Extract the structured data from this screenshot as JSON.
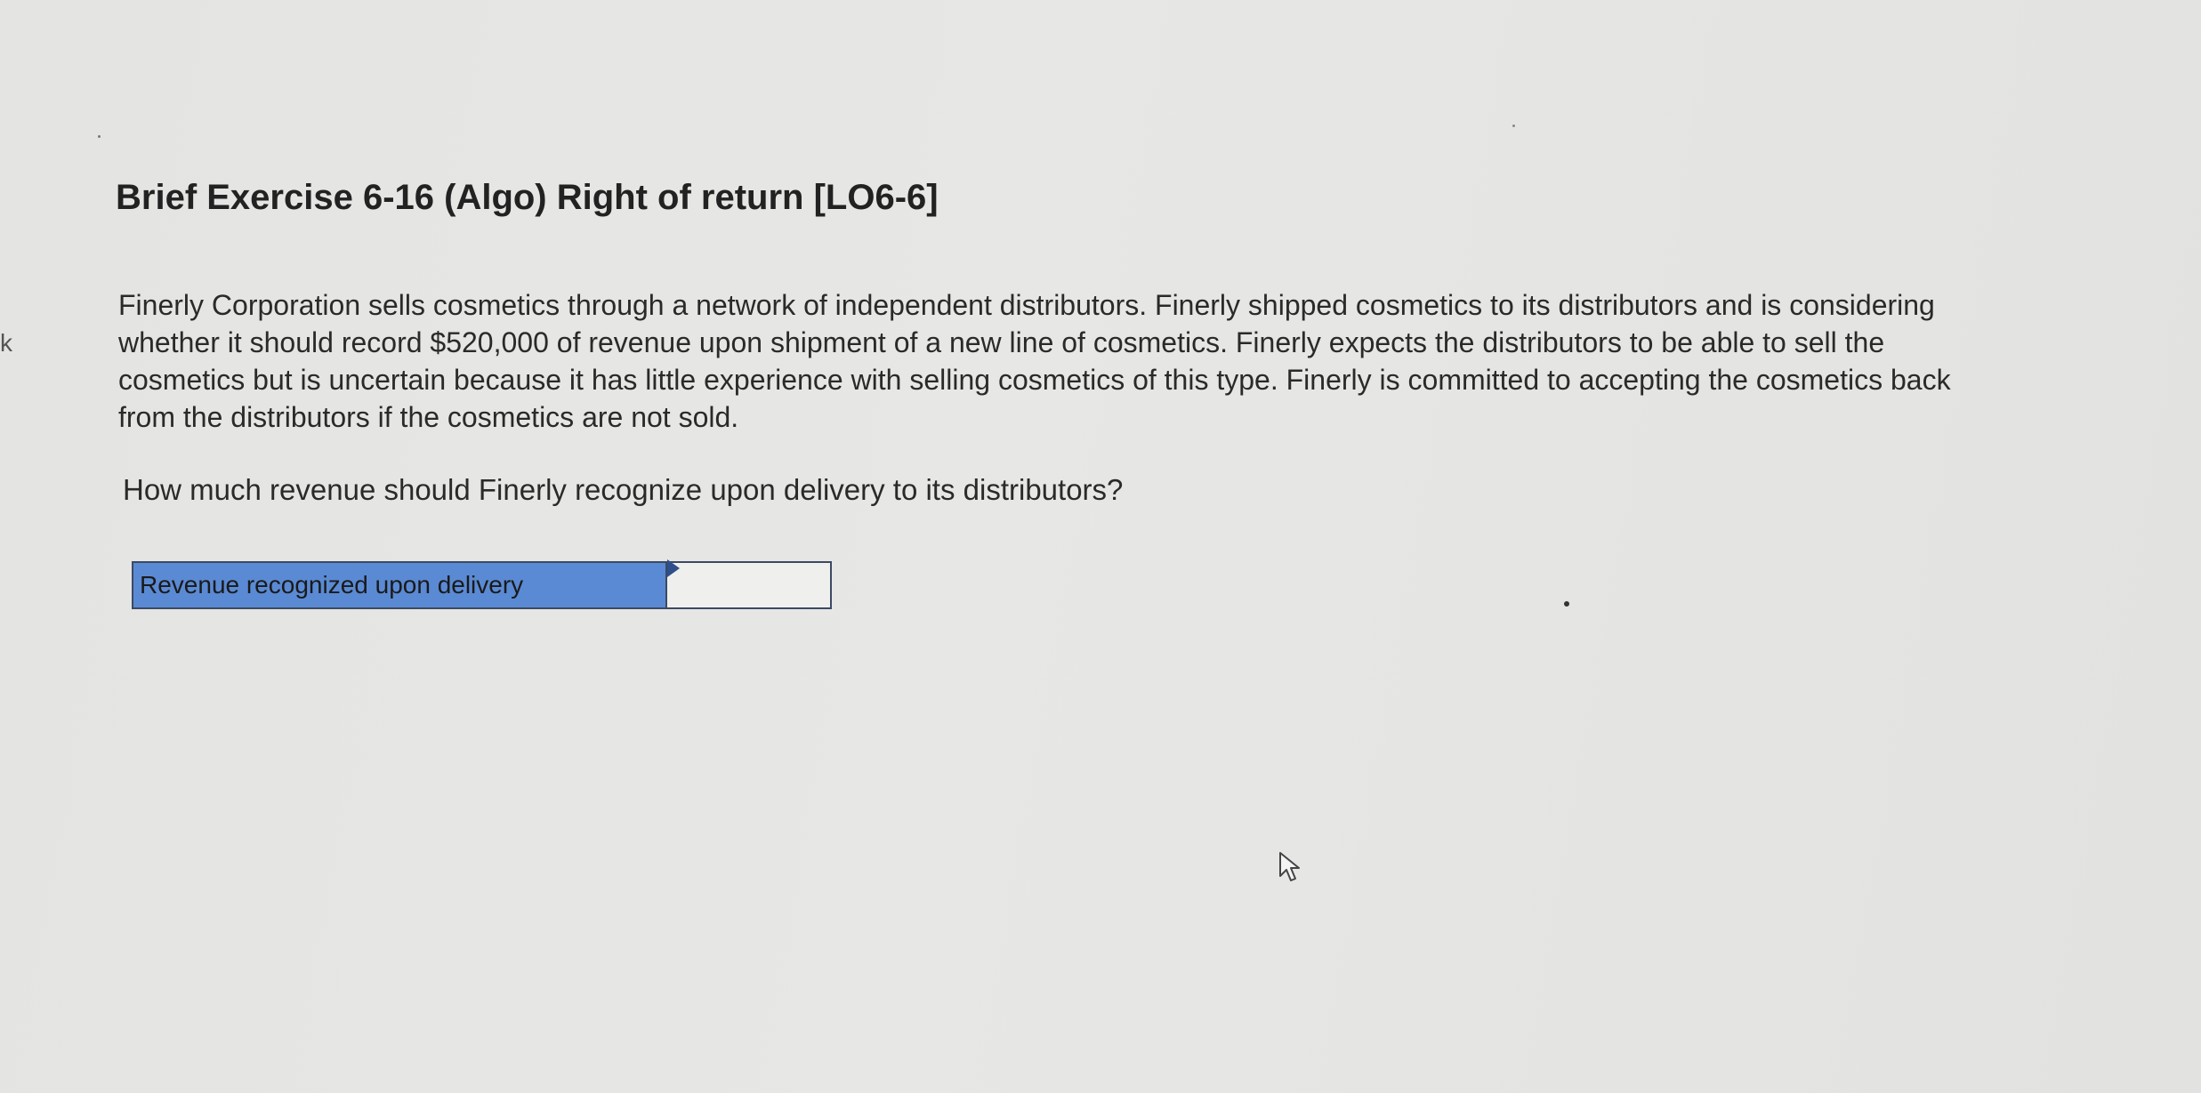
{
  "sidebar_edge_letter": "k",
  "exercise": {
    "title": "Brief Exercise 6-16 (Algo) Right of return [LO6-6]",
    "description": "Finerly Corporation sells cosmetics through a network of independent distributors. Finerly shipped cosmetics to its distributors and is considering whether it should record $520,000 of revenue upon shipment of a new line of cosmetics. Finerly expects the distributors to be able to sell the cosmetics but is uncertain because it has little experience with selling cosmetics of this type. Finerly is committed to accepting the cosmetics back from the distributors if the cosmetics are not sold.",
    "question": "How much revenue should Finerly recognize upon delivery to its distributors?"
  },
  "answer_table": {
    "label": "Revenue recognized upon delivery",
    "value": "",
    "label_bg_color": "#5a8ad4"
  },
  "icons": {
    "cursor": "mouse-pointer-icon"
  }
}
